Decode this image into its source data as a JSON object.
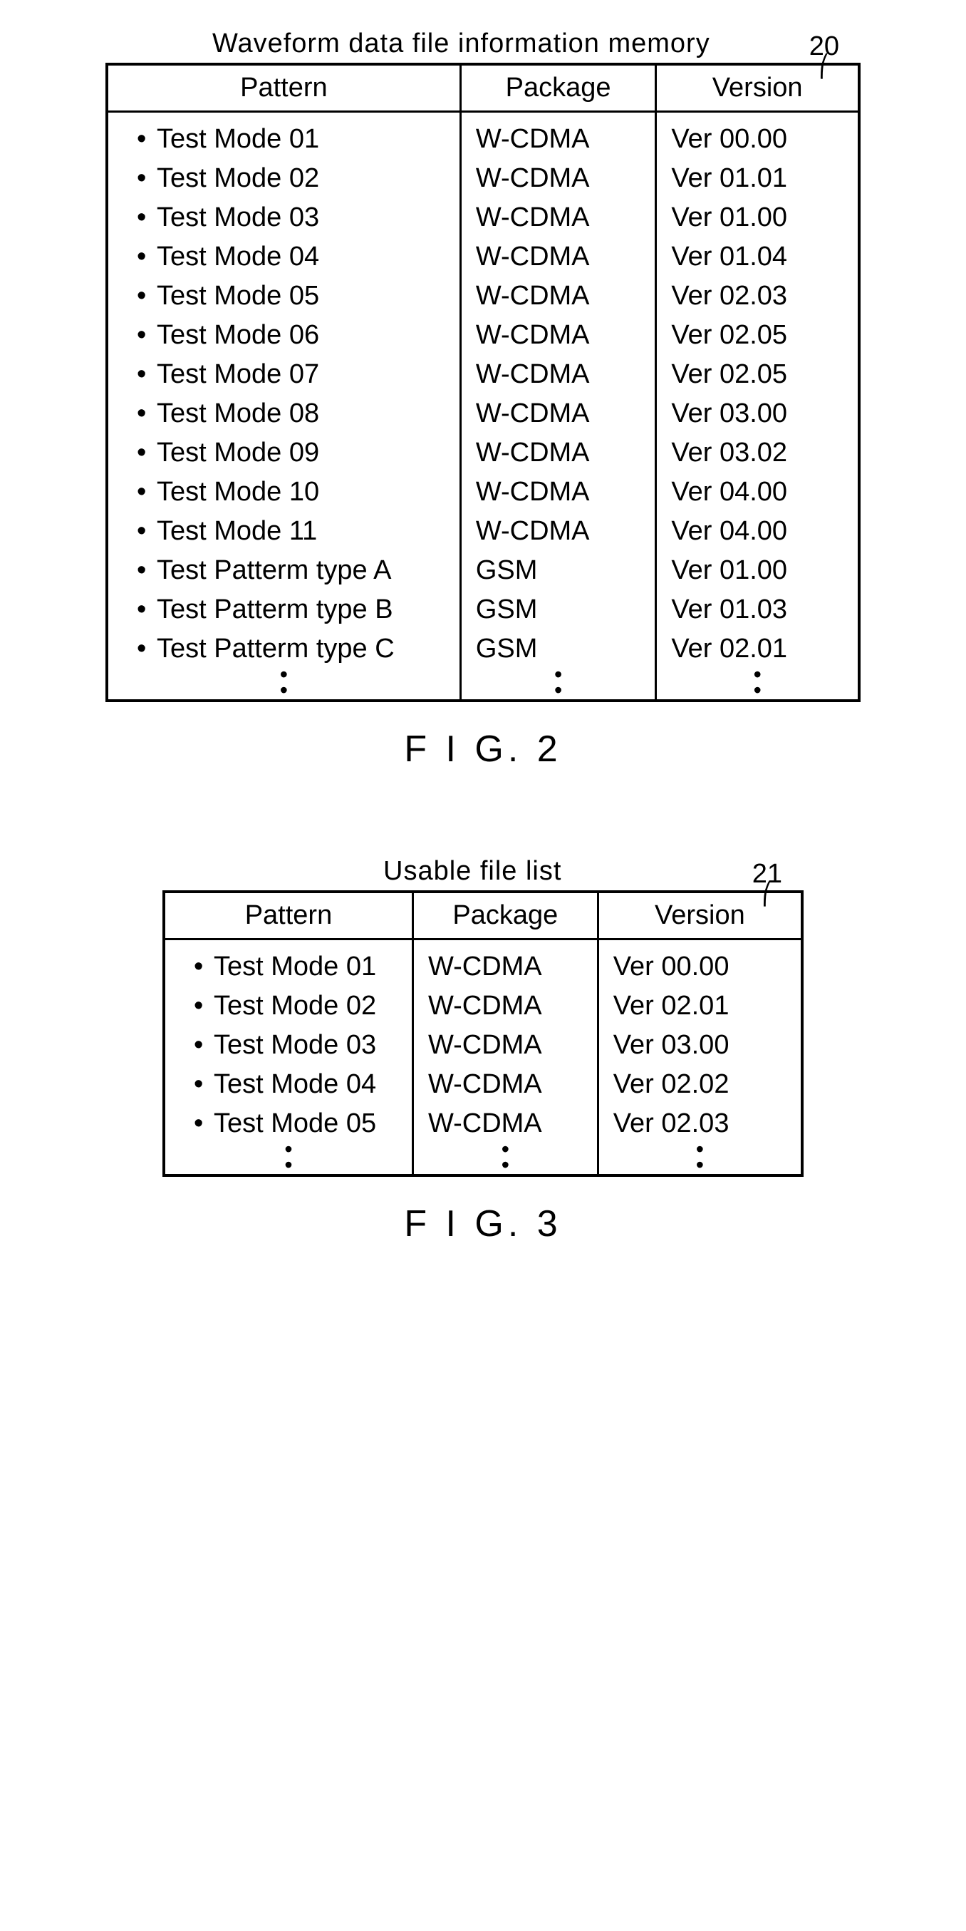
{
  "fig2": {
    "title": "Waveform data file information memory",
    "callout": "20",
    "headers": {
      "pattern": "Pattern",
      "package": "Package",
      "version": "Version"
    },
    "rows": [
      {
        "pattern": "Test Mode 01",
        "package": "W-CDMA",
        "version": "Ver 00.00"
      },
      {
        "pattern": "Test Mode 02",
        "package": "W-CDMA",
        "version": "Ver 01.01"
      },
      {
        "pattern": "Test Mode 03",
        "package": "W-CDMA",
        "version": "Ver 01.00"
      },
      {
        "pattern": "Test Mode 04",
        "package": "W-CDMA",
        "version": "Ver 01.04"
      },
      {
        "pattern": "Test Mode 05",
        "package": "W-CDMA",
        "version": "Ver 02.03"
      },
      {
        "pattern": "Test Mode 06",
        "package": "W-CDMA",
        "version": "Ver 02.05"
      },
      {
        "pattern": "Test Mode 07",
        "package": "W-CDMA",
        "version": "Ver 02.05"
      },
      {
        "pattern": "Test Mode 08",
        "package": "W-CDMA",
        "version": "Ver 03.00"
      },
      {
        "pattern": "Test Mode 09",
        "package": "W-CDMA",
        "version": "Ver 03.02"
      },
      {
        "pattern": "Test Mode 10",
        "package": "W-CDMA",
        "version": "Ver 04.00"
      },
      {
        "pattern": "Test Mode 11",
        "package": "W-CDMA",
        "version": "Ver 04.00"
      },
      {
        "pattern": "Test Patterm type A",
        "package": "GSM",
        "version": "Ver 01.00"
      },
      {
        "pattern": "Test Patterm type B",
        "package": "GSM",
        "version": "Ver 01.03"
      },
      {
        "pattern": "Test Patterm type C",
        "package": "GSM",
        "version": "Ver 02.01"
      }
    ],
    "caption": "F I G. 2"
  },
  "fig3": {
    "title": "Usable file list",
    "callout": "21",
    "headers": {
      "pattern": "Pattern",
      "package": "Package",
      "version": "Version"
    },
    "rows": [
      {
        "pattern": "Test Mode 01",
        "package": "W-CDMA",
        "version": "Ver 00.00"
      },
      {
        "pattern": "Test Mode 02",
        "package": "W-CDMA",
        "version": "Ver 02.01"
      },
      {
        "pattern": "Test Mode 03",
        "package": "W-CDMA",
        "version": "Ver 03.00"
      },
      {
        "pattern": "Test Mode 04",
        "package": "W-CDMA",
        "version": "Ver 02.02"
      },
      {
        "pattern": "Test Mode 05",
        "package": "W-CDMA",
        "version": "Ver 02.03"
      }
    ],
    "caption": "F I G. 3"
  }
}
